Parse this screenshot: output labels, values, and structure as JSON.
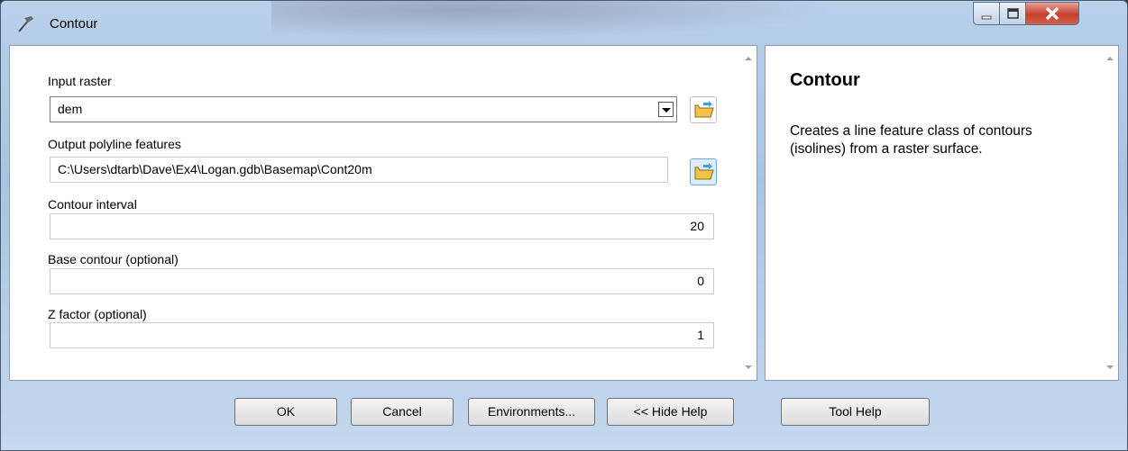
{
  "window": {
    "title": "Contour"
  },
  "title_icons": {
    "app_icon": "tool-hammer-icon",
    "minimize": "minimize-icon",
    "maximize": "maximize-icon",
    "close": "close-icon"
  },
  "form": {
    "input_raster": {
      "label": "Input raster",
      "value": "dem"
    },
    "output_polyline": {
      "label": "Output polyline features",
      "value": "C:\\Users\\dtarb\\Dave\\Ex4\\Logan.gdb\\Basemap\\Cont20m"
    },
    "contour_interval": {
      "label": "Contour interval",
      "value": "20"
    },
    "base_contour": {
      "label": "Base contour (optional)",
      "value": "0"
    },
    "z_factor": {
      "label": "Z factor (optional)",
      "value": "1"
    }
  },
  "help": {
    "title": "Contour",
    "body": "Creates a line feature class of contours (isolines) from a raster surface."
  },
  "buttons": {
    "ok": "OK",
    "cancel": "Cancel",
    "environments": "Environments...",
    "hide_help": "<< Hide Help",
    "tool_help": "Tool Help"
  },
  "colors": {
    "close_button": "#c6402c",
    "folder_yellow": "#f2c34a",
    "window_frame": "#b9d1ea"
  }
}
